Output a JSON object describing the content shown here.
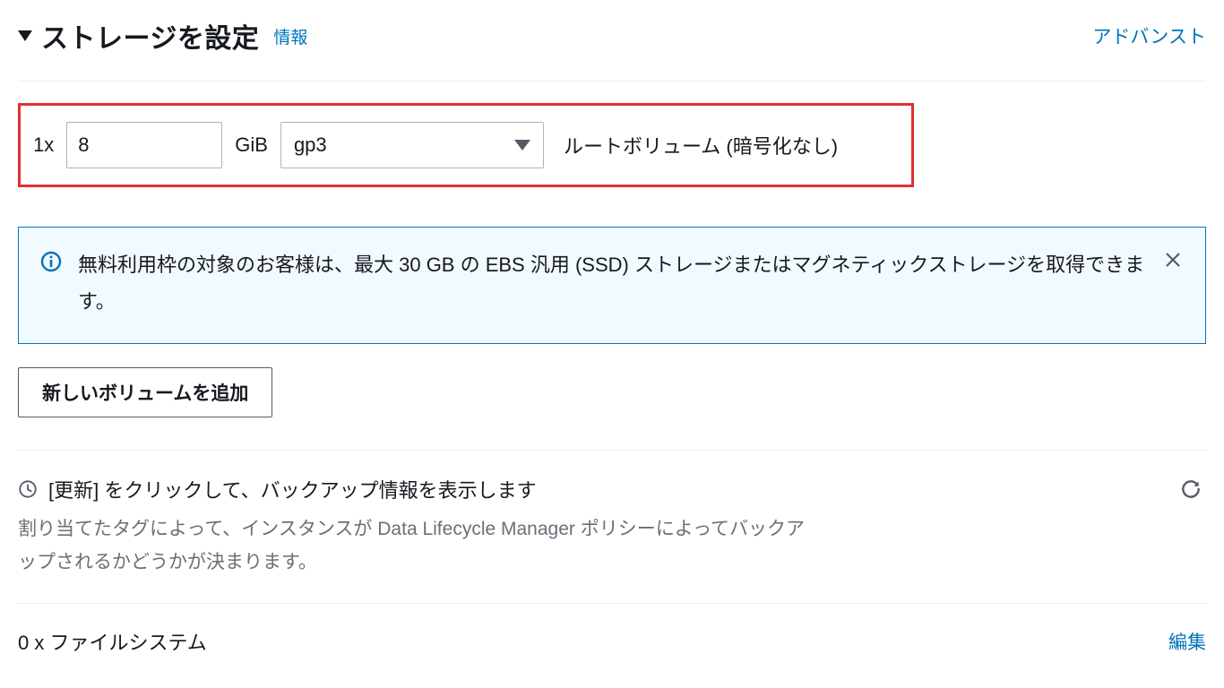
{
  "header": {
    "title": "ストレージを設定",
    "info_label": "情報",
    "advanced_label": "アドバンスト"
  },
  "volume": {
    "multiplier": "1x",
    "size_value": "8",
    "unit": "GiB",
    "type_selected": "gp3",
    "description": "ルートボリューム  (暗号化なし)"
  },
  "alert": {
    "message": "無料利用枠の対象のお客様は、最大 30 GB の EBS 汎用 (SSD) ストレージまたはマグネティックストレージを取得できます。"
  },
  "add_volume_label": "新しいボリュームを追加",
  "backup": {
    "headline": "[更新] をクリックして、バックアップ情報を表示します",
    "description": "割り当てたタグによって、インスタンスが Data Lifecycle Manager ポリシーによってバックアップされるかどうかが決まります。"
  },
  "filesystems": {
    "label": "0 x ファイルシステム",
    "edit_label": "編集"
  }
}
